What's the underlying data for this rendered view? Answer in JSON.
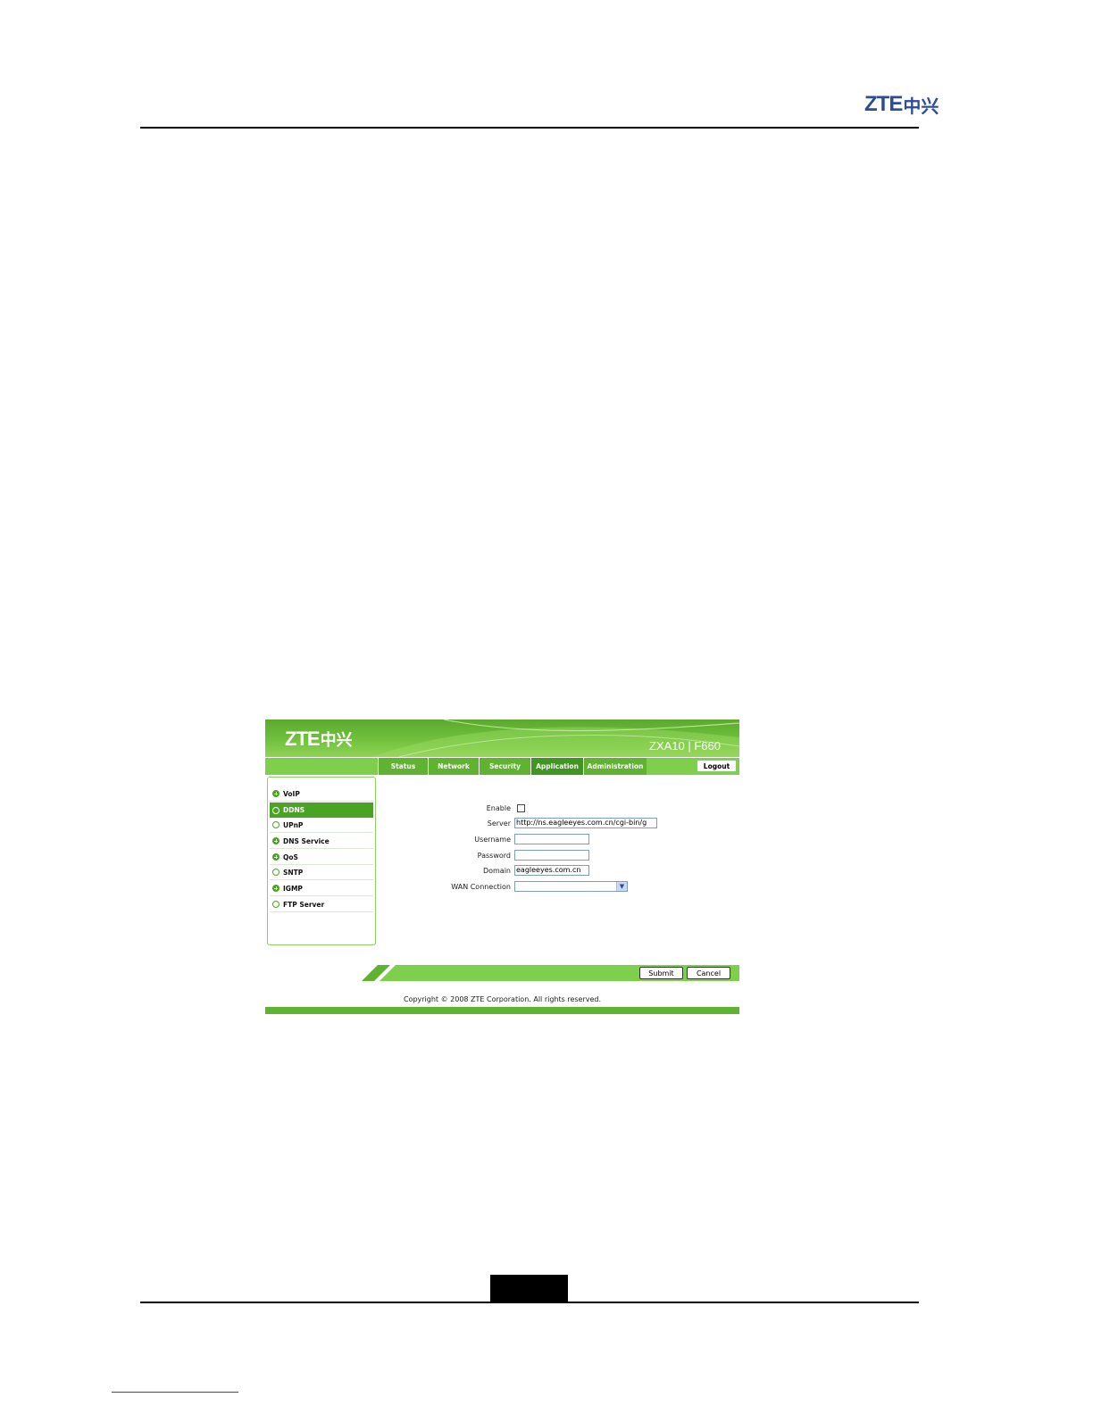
{
  "document": {
    "header_logo_latin": "ZTE",
    "header_logo_cjk": "中兴"
  },
  "ui": {
    "banner": {
      "logo_latin": "ZTE",
      "logo_cjk": "中兴",
      "model": "ZXA10 | F660"
    },
    "nav": {
      "tabs": [
        {
          "label": "Status"
        },
        {
          "label": "Network"
        },
        {
          "label": "Security"
        },
        {
          "label": "Application",
          "active": true
        },
        {
          "label": "Administration"
        }
      ],
      "logout_label": "Logout"
    },
    "sidebar": {
      "items": [
        {
          "label": "VoIP",
          "icon": "plus-circle-icon"
        },
        {
          "label": "DDNS",
          "icon": "ring-icon",
          "active": true
        },
        {
          "label": "UPnP",
          "icon": "ring-icon"
        },
        {
          "label": "DNS Service",
          "icon": "plus-circle-icon"
        },
        {
          "label": "QoS",
          "icon": "plus-circle-icon"
        },
        {
          "label": "SNTP",
          "icon": "ring-icon"
        },
        {
          "label": "IGMP",
          "icon": "plus-circle-icon"
        },
        {
          "label": "FTP Server",
          "icon": "ring-icon"
        }
      ]
    },
    "form": {
      "enable": {
        "label": "Enable",
        "checked": false
      },
      "server": {
        "label": "Server",
        "value": "http://ns.eagleeyes.com.cn/cgi-bin/g"
      },
      "username": {
        "label": "Username",
        "value": ""
      },
      "password": {
        "label": "Password",
        "value": ""
      },
      "domain": {
        "label": "Domain",
        "value": "eagleeyes.com.cn"
      },
      "wan_connection": {
        "label": "WAN Connection",
        "value": ""
      }
    },
    "actions": {
      "submit_label": "Submit",
      "cancel_label": "Cancel"
    },
    "footer": {
      "copyright": "Copyright © 2008 ZTE Corporation. All rights reserved."
    },
    "colors": {
      "brand_green": "#5fb330",
      "active_green": "#3f9620",
      "light_green": "#7ed04c",
      "doc_logo_blue": "#2b4c9b"
    }
  }
}
